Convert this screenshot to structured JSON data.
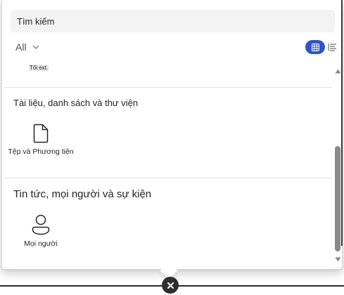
{
  "search": {
    "placeholder": "Tìm kiếm"
  },
  "filter": {
    "selected": "All",
    "icon": "chevron-down-icon"
  },
  "view_toggle": {
    "grid_icon": "grid-view-icon",
    "list_icon": "list-view-icon",
    "active": "grid"
  },
  "partial_item": {
    "label": "Tối ext."
  },
  "sections": [
    {
      "title": "Tài liệu, danh sách và thư viện",
      "tiles": [
        {
          "label": "Tệp và Phương tiện",
          "icon": "document-icon"
        }
      ]
    },
    {
      "title": "Tin tức, mọi người và sự kiện",
      "tiles": [
        {
          "label": "Mọi người",
          "icon": "person-icon"
        }
      ]
    }
  ],
  "colors": {
    "accent": "#2f54c9",
    "close_bg": "#2e2e2e",
    "scroll_thumb": "#8a8a8a"
  }
}
